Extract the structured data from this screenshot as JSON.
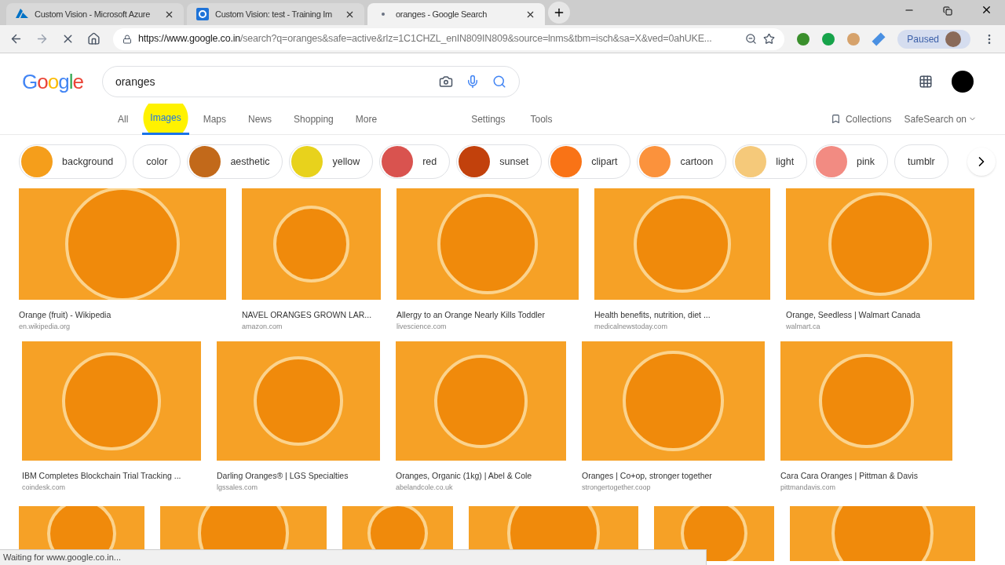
{
  "browser_tabs": [
    {
      "title": "Custom Vision - Microsoft Azure",
      "kind": "azure",
      "selected": false
    },
    {
      "title": "Custom Vision: test - Training Im",
      "kind": "vision",
      "selected": false
    },
    {
      "title": "oranges - Google Search",
      "kind": "loading",
      "selected": true
    }
  ],
  "address_bar": {
    "host": "https://www.google.co.in",
    "path": "/search?q=oranges&safe=active&rlz=1C1CHZL_enIN809IN809&source=lnms&tbm=isch&sa=X&ved=0ahUKE..."
  },
  "profile": {
    "label": "Paused"
  },
  "logo": "Google",
  "search": {
    "value": "oranges"
  },
  "nav_tabs": [
    {
      "label": "All",
      "selected": false
    },
    {
      "label": "Images",
      "selected": true
    },
    {
      "label": "Maps",
      "selected": false
    },
    {
      "label": "News",
      "selected": false
    },
    {
      "label": "Shopping",
      "selected": false
    },
    {
      "label": "More",
      "selected": false
    }
  ],
  "tools": [
    "Settings",
    "Tools"
  ],
  "collections": "Collections",
  "safesearch": "SafeSearch on",
  "chips": [
    {
      "label": "background",
      "kind": "image",
      "color": "#f59e1b"
    },
    {
      "label": "color",
      "kind": "text"
    },
    {
      "label": "aesthetic",
      "kind": "image",
      "color": "#c2691a"
    },
    {
      "label": "yellow",
      "kind": "image",
      "color": "#e8d21c"
    },
    {
      "label": "red",
      "kind": "image",
      "color": "#d9534f"
    },
    {
      "label": "sunset",
      "kind": "image",
      "color": "#c2410c"
    },
    {
      "label": "clipart",
      "kind": "image",
      "color": "#f97316"
    },
    {
      "label": "cartoon",
      "kind": "image",
      "color": "#fb923c"
    },
    {
      "label": "light",
      "kind": "image",
      "color": "#f5c97a"
    },
    {
      "label": "pink",
      "kind": "image",
      "color": "#f28b82"
    },
    {
      "label": "tumblr",
      "kind": "text"
    }
  ],
  "results": [
    [
      {
        "title": "Orange (fruit) - Wikipedia",
        "source": "en.wikipedia.org"
      },
      {
        "title": "NAVEL ORANGES GROWN LAR...",
        "source": "amazon.com"
      },
      {
        "title": "Allergy to an Orange Nearly Kills Toddler",
        "source": "livescience.com"
      },
      {
        "title": "Health benefits, nutrition, diet ...",
        "source": "medicalnewstoday.com"
      },
      {
        "title": "Orange, Seedless | Walmart Canada",
        "source": "walmart.ca"
      }
    ],
    [
      {
        "title": "IBM Completes Blockchain Trial Tracking ...",
        "source": "coindesk.com"
      },
      {
        "title": "Darling Oranges® | LGS Specialties",
        "source": "lgssales.com"
      },
      {
        "title": "Oranges, Organic (1kg) | Abel & Cole",
        "source": "abelandcole.co.uk"
      },
      {
        "title": "Oranges | Co+op, stronger together",
        "source": "strongertogether.coop"
      },
      {
        "title": "Cara Cara Oranges | Pittman & Davis",
        "source": "pittmandavis.com"
      }
    ]
  ],
  "status_bar": "Waiting for www.google.co.in..."
}
